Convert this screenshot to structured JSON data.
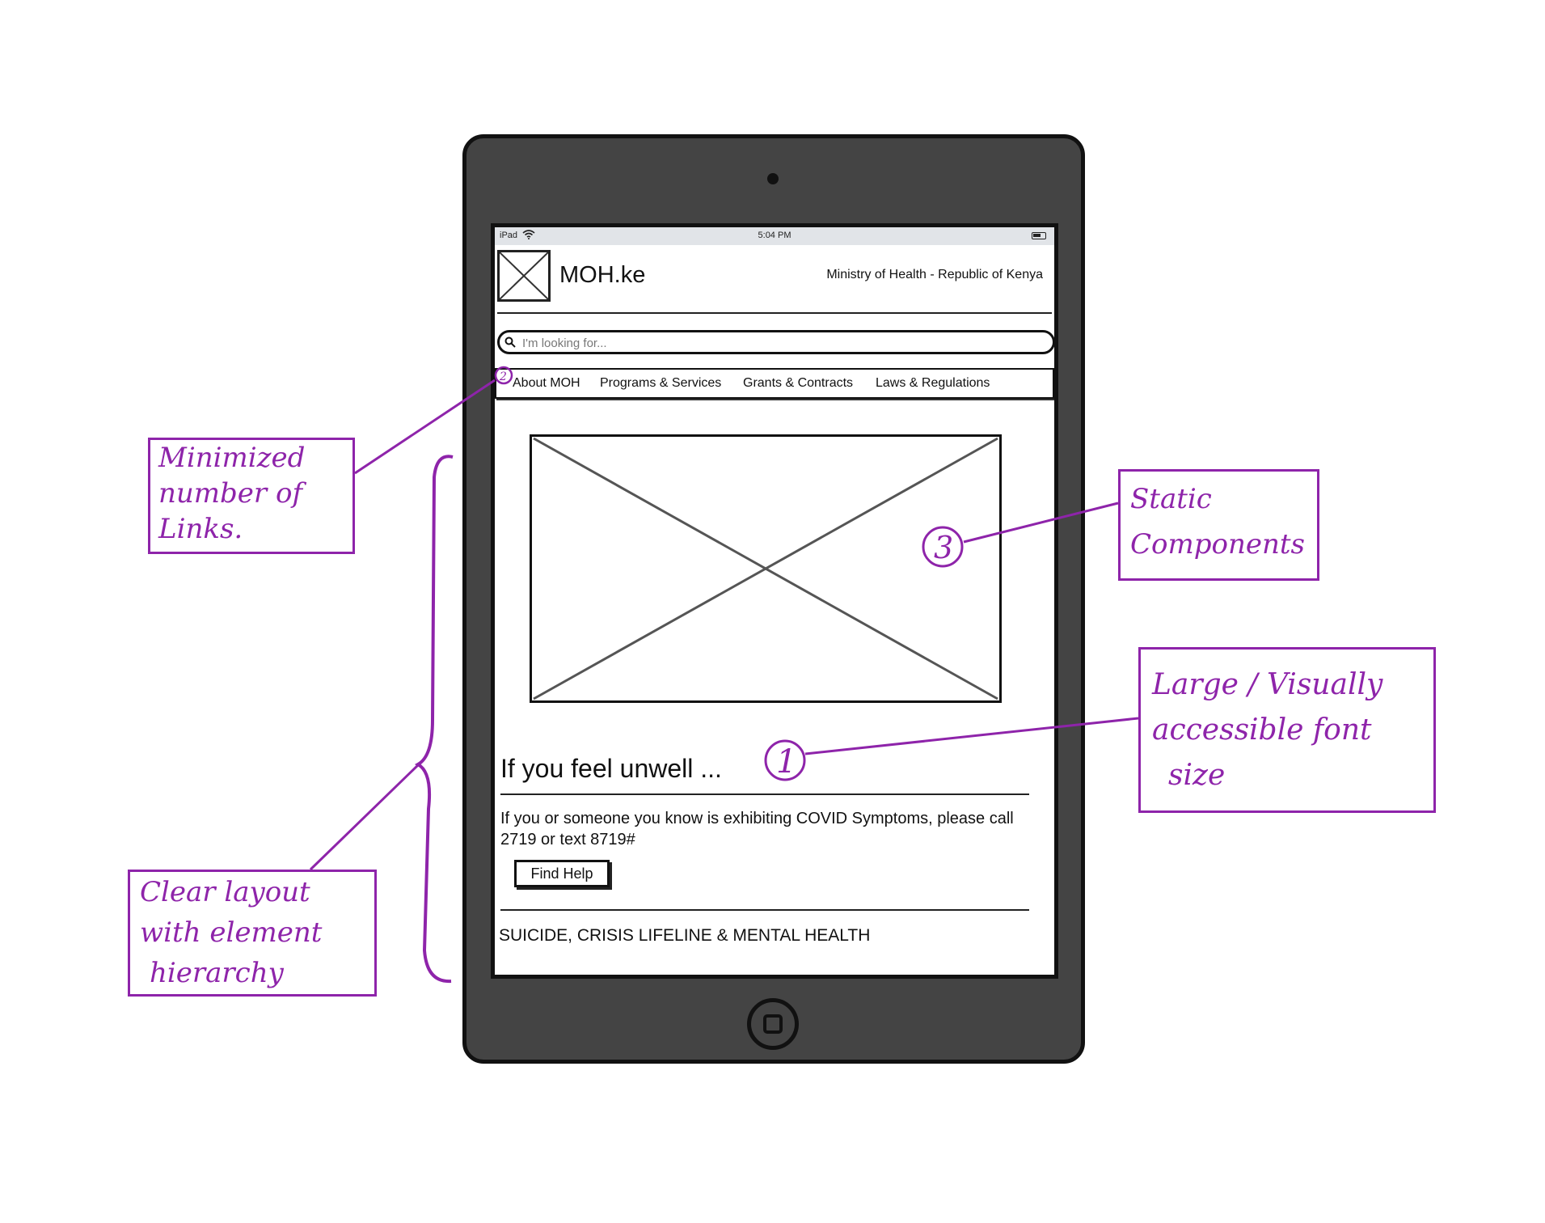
{
  "device": {
    "status_bar": {
      "carrier": "iPad",
      "time": "5:04 PM"
    },
    "header": {
      "site_name": "MOH.ke",
      "subtitle": "Ministry of Health - Republic of Kenya"
    },
    "search": {
      "placeholder": "I'm looking for..."
    },
    "nav": {
      "items": [
        "About MOH",
        "Programs & Services",
        "Grants & Contracts",
        "Laws & Regulations"
      ]
    },
    "content": {
      "title": "If you feel unwell ...",
      "body": "If you or someone you know is exhibiting COVID Symptoms, please call 2719 or text 8719#",
      "button_label": "Find Help",
      "section_link": "SUICIDE, CRISIS LIFELINE & MENTAL HEALTH"
    }
  },
  "annotations": {
    "links": {
      "number": "2",
      "text_lines": [
        "Minimized",
        "number of",
        "Links."
      ]
    },
    "static": {
      "number": "3",
      "text_lines": [
        "Static",
        "Components"
      ]
    },
    "font": {
      "number": "1",
      "text_lines": [
        "Large / Visually",
        "accessible font",
        "size"
      ]
    },
    "layout": {
      "text_lines": [
        "Clear layout",
        "with element",
        "hierarchy"
      ]
    }
  },
  "colors": {
    "annotation": "#8e24aa",
    "device_body": "#444444",
    "status_bar": "#e1e4e8"
  }
}
